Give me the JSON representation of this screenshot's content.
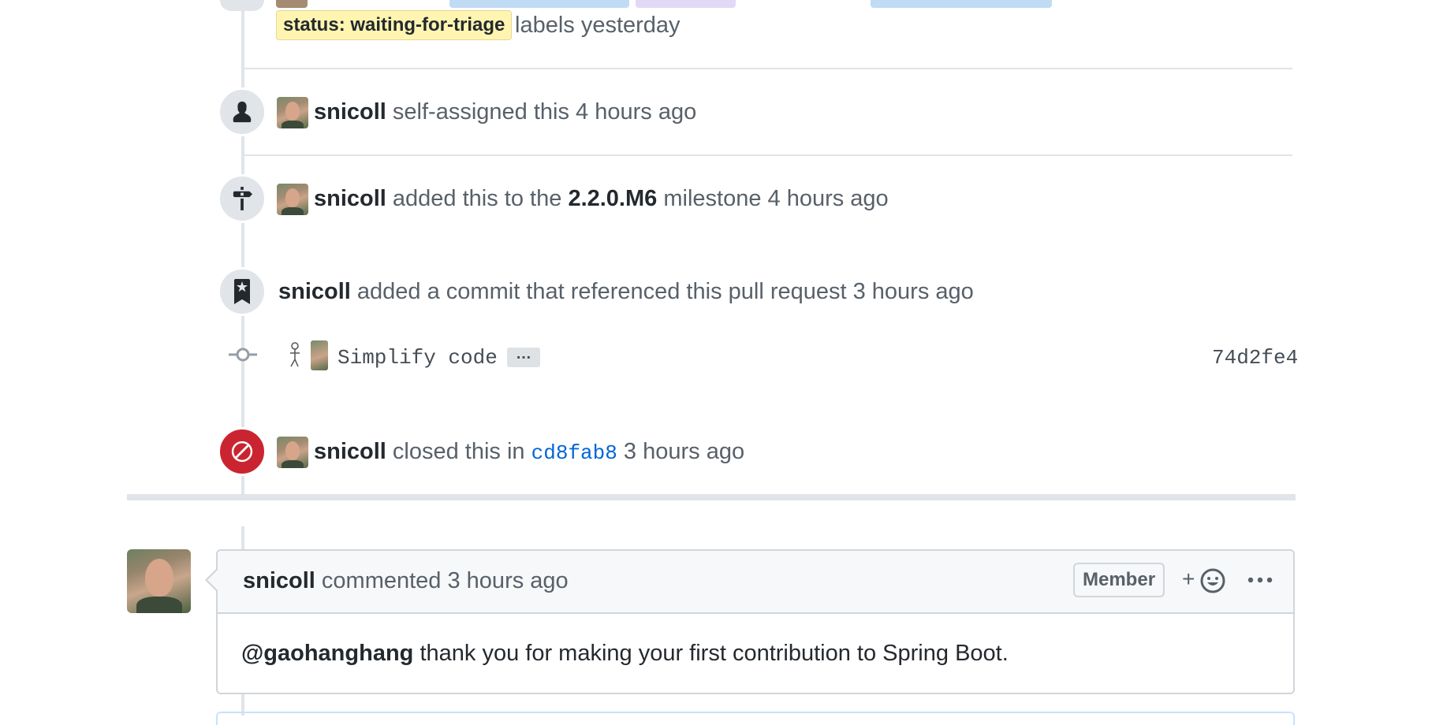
{
  "colors": {
    "label_triage_bg": "#fff5b1",
    "closed_badge": "#cb2431",
    "link": "#0366d6"
  },
  "timeline": {
    "labels_event": {
      "label": "status: waiting-for-triage",
      "text": "labels yesterday"
    },
    "assign_event": {
      "icon": "person-icon",
      "author": "snicoll",
      "text": "self-assigned this 4 hours ago"
    },
    "milestone_event": {
      "icon": "milestone-icon",
      "author": "snicoll",
      "text_before": "added this to the",
      "milestone": "2.2.0.M6",
      "text_after": "milestone 4 hours ago"
    },
    "reference_event": {
      "icon": "bookmark-icon",
      "author": "snicoll",
      "text": "added a commit that referenced this pull request 3 hours ago"
    },
    "commit": {
      "icon": "commit-icon",
      "message": "Simplify code",
      "expand": "…",
      "sha": "74d2fe4"
    },
    "closed_event": {
      "icon": "circle-slash-icon",
      "author": "snicoll",
      "text_before": "closed this in",
      "sha": "cd8fab8",
      "text_after": "3 hours ago"
    }
  },
  "comment": {
    "author": "snicoll",
    "meta": "commented 3 hours ago",
    "role": "Member",
    "reaction": "+☺",
    "more": "•••",
    "mention": "@gaohanghang",
    "body": "thank you for making your first contribution to Spring Boot."
  }
}
